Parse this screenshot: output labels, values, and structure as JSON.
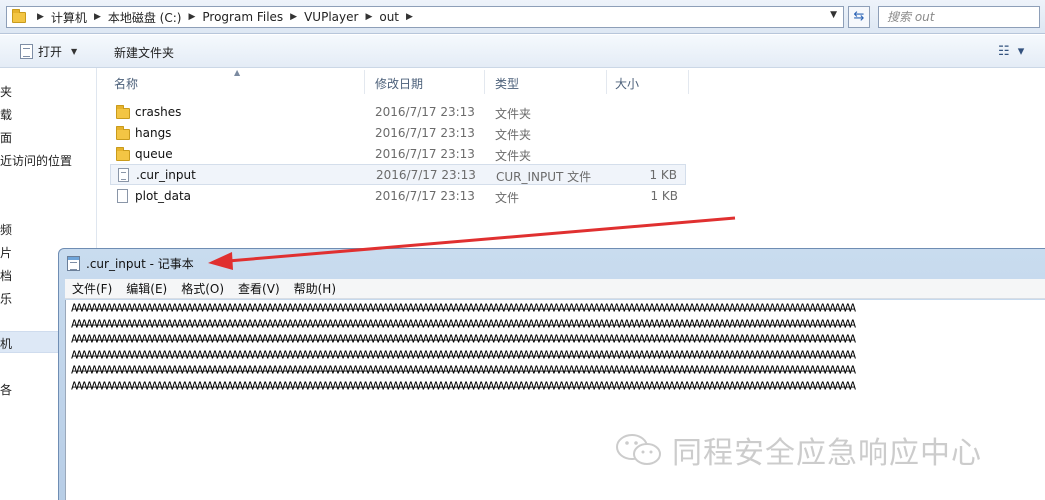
{
  "address_bar": {
    "breadcrumbs": [
      "计算机",
      "本地磁盘 (C:)",
      "Program Files",
      "VUPlayer",
      "out"
    ],
    "search_placeholder": "搜索 out"
  },
  "toolbar": {
    "open_label": "打开",
    "new_folder_label": "新建文件夹"
  },
  "nav": {
    "items": [
      {
        "label": "夹"
      },
      {
        "label": "载"
      },
      {
        "label": "面"
      },
      {
        "label": "近访问的位置"
      },
      {
        "label": "频"
      },
      {
        "label": "片"
      },
      {
        "label": "档"
      },
      {
        "label": "乐"
      },
      {
        "label": "机",
        "selected": true
      },
      {
        "label": "各"
      }
    ]
  },
  "file_list": {
    "columns": {
      "name": "名称",
      "date": "修改日期",
      "type": "类型",
      "size": "大小"
    },
    "rows": [
      {
        "name": "crashes",
        "date": "2016/7/17 23:13",
        "type": "文件夹",
        "size": "",
        "icon": "folder-icon"
      },
      {
        "name": "hangs",
        "date": "2016/7/17 23:13",
        "type": "文件夹",
        "size": "",
        "icon": "folder-icon"
      },
      {
        "name": "queue",
        "date": "2016/7/17 23:13",
        "type": "文件夹",
        "size": "",
        "icon": "folder-icon"
      },
      {
        "name": ".cur_input",
        "date": "2016/7/17 23:13",
        "type": "CUR_INPUT 文件",
        "size": "1 KB",
        "icon": "text-file-icon",
        "highlighted": true
      },
      {
        "name": "plot_data",
        "date": "2016/7/17 23:13",
        "type": "文件",
        "size": "1 KB",
        "icon": "file-icon"
      }
    ]
  },
  "notepad": {
    "title": ".cur_input - 记事本",
    "menu": [
      "文件(F)",
      "编辑(E)",
      "格式(O)",
      "查看(V)",
      "帮助(H)"
    ],
    "content_lines": [
      "AAAAAAAAAAAAAAAAAAAAAAAAAAAAAAAAAAAAAAAAAAAAAAAAAAAAAAAAAAAAAAAAAAAAAAAAAAAAAAAAAAAAAAAAAAAAAAAAAAAAAAAAAAAAAAAAAAAAAAAAAAAAAAAAAAAAAAAAAAAAAAAAAAAAAAAAAAAA",
      "AAAAAAAAAAAAAAAAAAAAAAAAAAAAAAAAAAAAAAAAAAAAAAAAAAAAAAAAAAAAAAAAAAAAAAAAAAAAAAAAAAAAAAAAAAAAAAAAAAAAAAAAAAAAAAAAAAAAAAAAAAAAAAAAAAAAAAAAAAAAAAAAAAAAAAAAAAAA",
      "AAAAAAAAAAAAAAAAAAAAAAAAAAAAAAAAAAAAAAAAAAAAAAAAAAAAAAAAAAAAAAAAAAAAAAAAAAAAAAAAAAAAAAAAAAAAAAAAAAAAAAAAAAAAAAAAAAAAAAAAAAAAAAAAAAAAAAAAAAAAAAAAAAAAAAAAAAAA",
      "AAAAAAAAAAAAAAAAAAAAAAAAAAAAAAAAAAAAAAAAAAAAAAAAAAAAAAAAAAAAAAAAAAAAAAAAAAAAAAAAAAAAAAAAAAAAAAAAAAAAAAAAAAAAAAAAAAAAAAAAAAAAAAAAAAAAAAAAAAAAAAAAAAAAAAAAAAAA",
      "AAAAAAAAAAAAAAAAAAAAAAAAAAAAAAAAAAAAAAAAAAAAAAAAAAAAAAAAAAAAAAAAAAAAAAAAAAAAAAAAAAAAAAAAAAAAAAAAAAAAAAAAAAAAAAAAAAAAAAAAAAAAAAAAAAAAAAAAAAAAAAAAAAAAAAAAAAAA",
      "AAAAAAAAAAAAAAAAAAAAAAAAAAAAAAAAAAAAAAAAAAAAAAAAAAAAAAAAAAAAAAAAAAAAAAAAAAAAAAAAAAAAAAAAAAAAAAAAAAAAAAAAAAAAAAAAAAAAAAAAAAAAAAAAAAAAAAAAAAAAAAAAAAAAAAAAAAAA"
    ]
  },
  "watermark": {
    "text": "同程安全应急响应中心"
  },
  "colors": {
    "annotation_arrow": "#e03030",
    "selection": "#dde8f6",
    "folder": "#f3c544"
  }
}
